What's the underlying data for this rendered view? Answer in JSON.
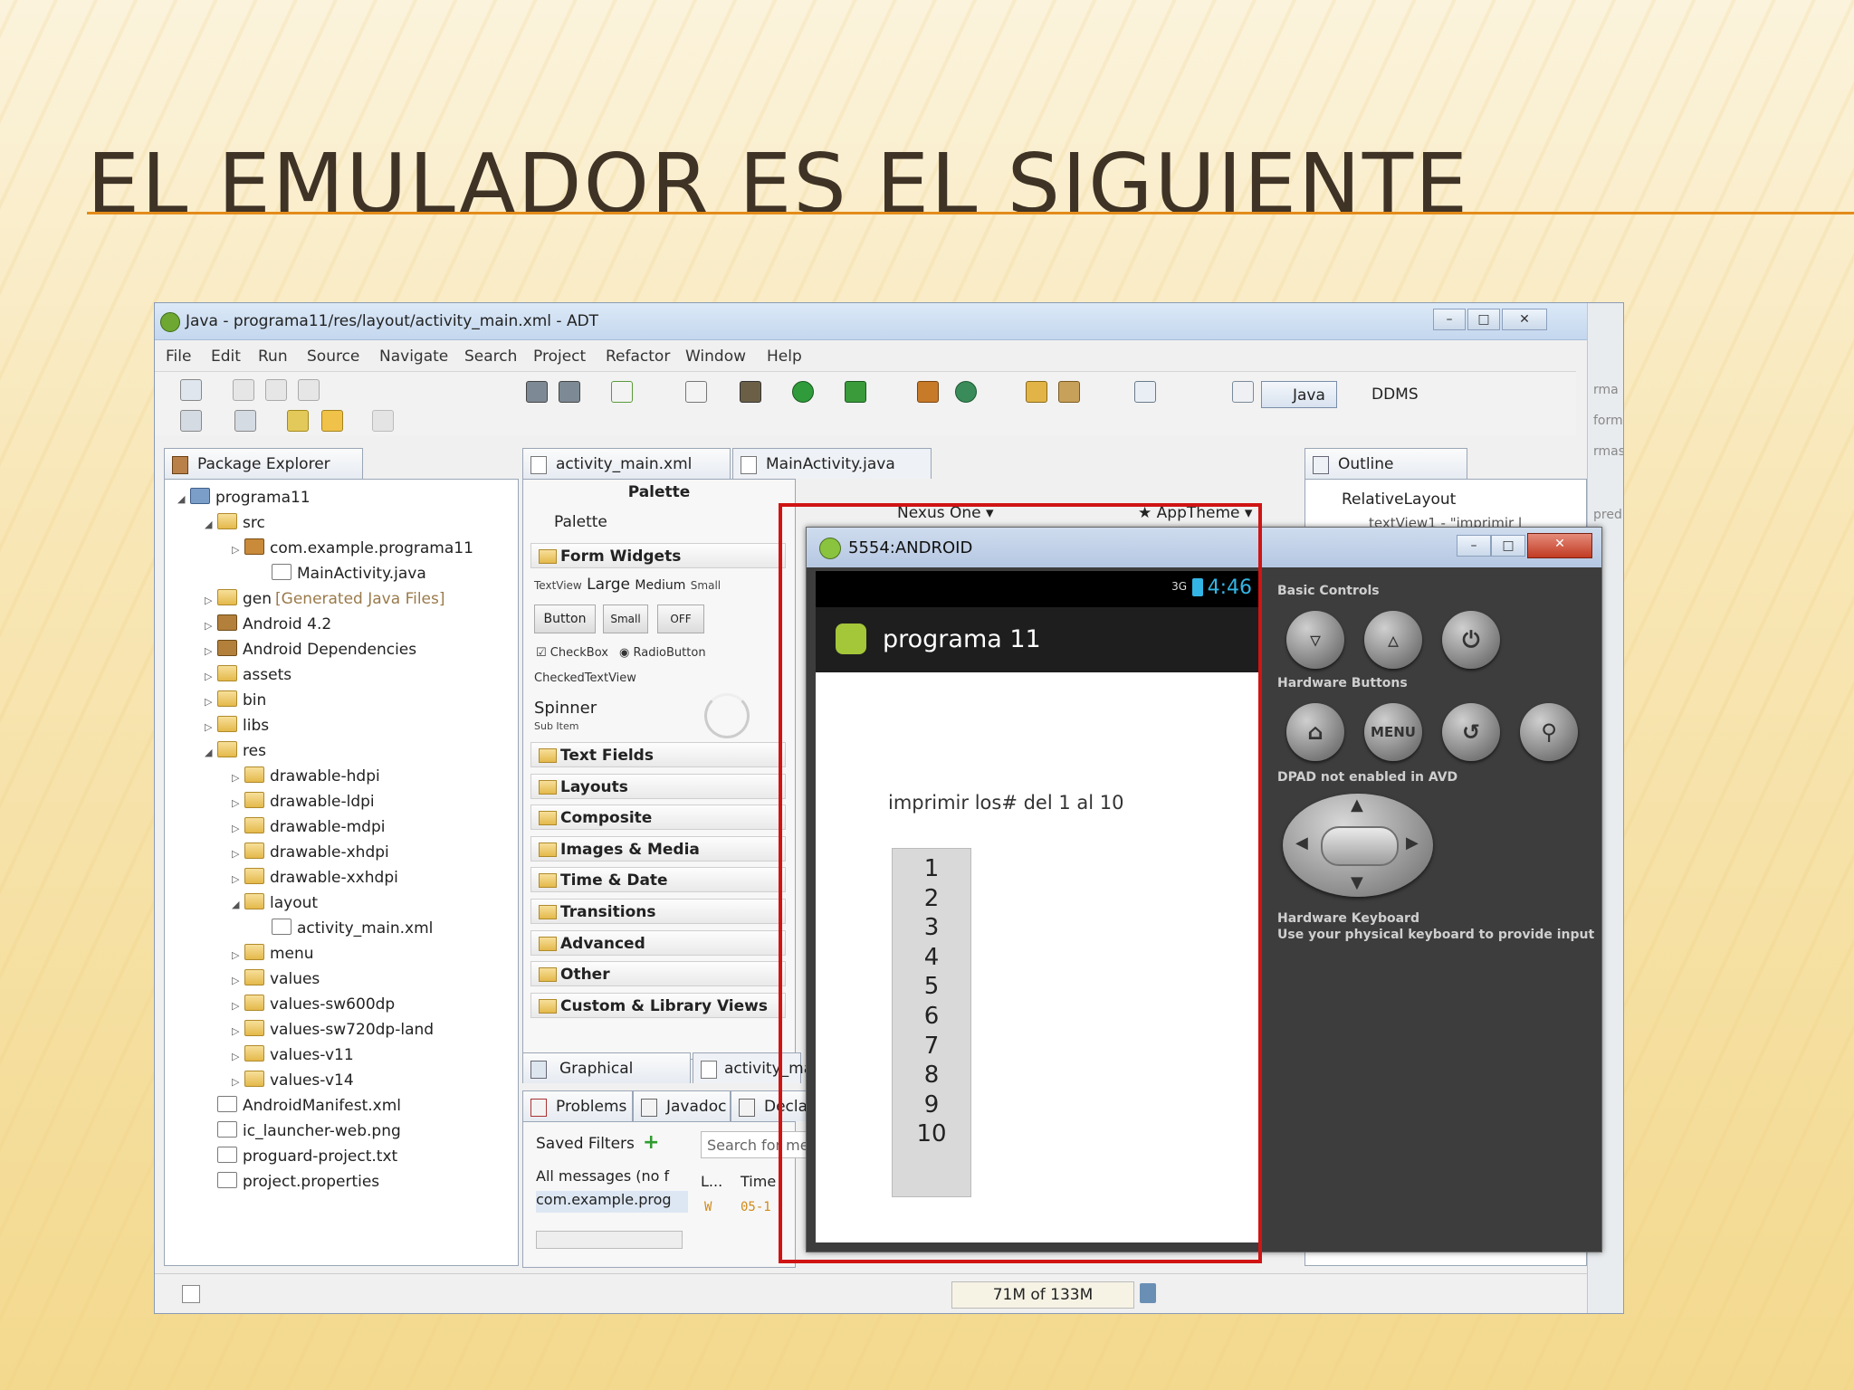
{
  "slide": {
    "title": "EL EMULADOR ES EL SIGUIENTE"
  },
  "window": {
    "title": "Java - programa11/res/layout/activity_main.xml - ADT"
  },
  "menu": [
    "File",
    "Edit",
    "Run",
    "Source",
    "Navigate",
    "Search",
    "Project",
    "Refactor",
    "Window",
    "Help"
  ],
  "perspectives": {
    "java": "Java",
    "ddms": "DDMS"
  },
  "package_explorer": {
    "tab": "Package Explorer",
    "items": [
      {
        "label": "programa11",
        "indent": 0,
        "icon": "proj"
      },
      {
        "label": "src",
        "indent": 1,
        "icon": "folder"
      },
      {
        "label": "com.example.programa11",
        "indent": 2,
        "icon": "pkg"
      },
      {
        "label": "MainActivity.java",
        "indent": 3,
        "icon": "jfile"
      },
      {
        "label": "gen",
        "indent": 1,
        "icon": "folder",
        "suffix": "[Generated Java Files]"
      },
      {
        "label": "Android 4.2",
        "indent": 1,
        "icon": "lib"
      },
      {
        "label": "Android Dependencies",
        "indent": 1,
        "icon": "lib"
      },
      {
        "label": "assets",
        "indent": 1,
        "icon": "folder"
      },
      {
        "label": "bin",
        "indent": 1,
        "icon": "folder"
      },
      {
        "label": "libs",
        "indent": 1,
        "icon": "folder"
      },
      {
        "label": "res",
        "indent": 1,
        "icon": "folder"
      },
      {
        "label": "drawable-hdpi",
        "indent": 2,
        "icon": "folder"
      },
      {
        "label": "drawable-ldpi",
        "indent": 2,
        "icon": "folder"
      },
      {
        "label": "drawable-mdpi",
        "indent": 2,
        "icon": "folder"
      },
      {
        "label": "drawable-xhdpi",
        "indent": 2,
        "icon": "folder"
      },
      {
        "label": "drawable-xxhdpi",
        "indent": 2,
        "icon": "folder"
      },
      {
        "label": "layout",
        "indent": 2,
        "icon": "folder"
      },
      {
        "label": "activity_main.xml",
        "indent": 3,
        "icon": "jfile"
      },
      {
        "label": "menu",
        "indent": 2,
        "icon": "folder"
      },
      {
        "label": "values",
        "indent": 2,
        "icon": "folder"
      },
      {
        "label": "values-sw600dp",
        "indent": 2,
        "icon": "folder"
      },
      {
        "label": "values-sw720dp-land",
        "indent": 2,
        "icon": "folder"
      },
      {
        "label": "values-v11",
        "indent": 2,
        "icon": "folder"
      },
      {
        "label": "values-v14",
        "indent": 2,
        "icon": "folder"
      },
      {
        "label": "AndroidManifest.xml",
        "indent": 1,
        "icon": "jfile"
      },
      {
        "label": "ic_launcher-web.png",
        "indent": 1,
        "icon": "jfile"
      },
      {
        "label": "proguard-project.txt",
        "indent": 1,
        "icon": "jfile"
      },
      {
        "label": "project.properties",
        "indent": 1,
        "icon": "jfile"
      }
    ]
  },
  "editor_tabs": [
    "activity_main.xml",
    "MainActivity.java"
  ],
  "palette": {
    "header": "Palette",
    "dropdown": "Palette",
    "form_widgets": "Form Widgets",
    "textview_sizes": {
      "tv": "TextView",
      "large": "Large",
      "medium": "Medium",
      "small": "Small"
    },
    "buttons": {
      "button": "Button",
      "small": "Small",
      "off": "OFF"
    },
    "checks": {
      "checkbox": "CheckBox",
      "radio": "RadioButton",
      "checked": "CheckedTextView"
    },
    "spinner": {
      "label": "Spinner",
      "sub": "Sub Item"
    },
    "categories": [
      "Text Fields",
      "Layouts",
      "Composite",
      "Images & Media",
      "Time & Date",
      "Transitions",
      "Advanced",
      "Other",
      "Custom & Library Views"
    ]
  },
  "editor_bottom_tabs": {
    "graphical": "Graphical Layout",
    "xml": "activity_mai"
  },
  "config_bar": {
    "device": "Nexus One",
    "theme": "AppTheme"
  },
  "outline": {
    "tab": "Outline",
    "root": "RelativeLayout",
    "child": "textView1 - \"imprimir l"
  },
  "bottom_panel": {
    "tabs": [
      "Problems",
      "Javadoc",
      "Declar"
    ],
    "saved_filters": "Saved Filters",
    "search_placeholder": "Search for me",
    "all_messages": "All messages (no f",
    "filter_item": "com.example.prog",
    "col_level": "L...",
    "col_time": "Time",
    "log_level": "W",
    "log_time": "05-1"
  },
  "memory": "71M of 133M",
  "emulator": {
    "title": "5554:ANDROID",
    "clock": "4:46",
    "signal": "3G",
    "app_title": "programa 11",
    "message": "imprimir los# del 1 al 10",
    "numbers": [
      "1",
      "2",
      "3",
      "4",
      "5",
      "6",
      "7",
      "8",
      "9",
      "10"
    ],
    "basic_controls": "Basic Controls",
    "hardware_buttons": "Hardware Buttons",
    "menu_label": "MENU",
    "dpad_label": "DPAD not enabled in AVD",
    "keyboard_title": "Hardware Keyboard",
    "keyboard_desc": "Use your physical keyboard to provide input"
  },
  "background_peek": [
    "rma",
    "form",
    "rmas",
    "pred"
  ],
  "colors": {
    "highlight_frame": "#d01414",
    "title_rule": "#e38b1a",
    "clock": "#33b5e5"
  }
}
